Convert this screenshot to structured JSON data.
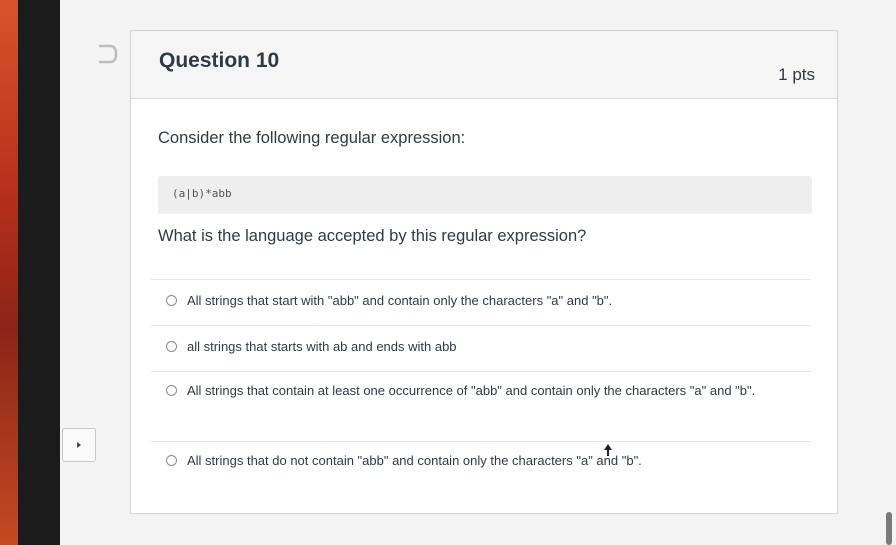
{
  "question": {
    "title": "Question 10",
    "points": "1 pts",
    "prompt": "Consider the following regular expression:",
    "code": "(a|b)*abb",
    "text": "What is the language accepted by this regular expression?"
  },
  "answers": [
    {
      "label": "All strings that start with \"abb\" and contain only the characters \"a\" and \"b\".",
      "selected": false
    },
    {
      "label": "all strings that starts with ab and ends with abb",
      "selected": false
    },
    {
      "label": "All strings that contain at least one occurrence of \"abb\" and contain only the characters \"a\" and \"b\".",
      "selected": false
    },
    {
      "label": "All strings that do not contain \"abb\" and contain only the characters \"a\" and \"b\".",
      "selected": false
    }
  ],
  "icons": {
    "flag": "bookmark-flag-icon",
    "toggle": "caret-right-icon",
    "cursor": "mouse-cursor-icon"
  },
  "colors": {
    "text": "#2d3b45",
    "code_bg": "#eeeeee",
    "header_bg": "#f5f5f5"
  }
}
